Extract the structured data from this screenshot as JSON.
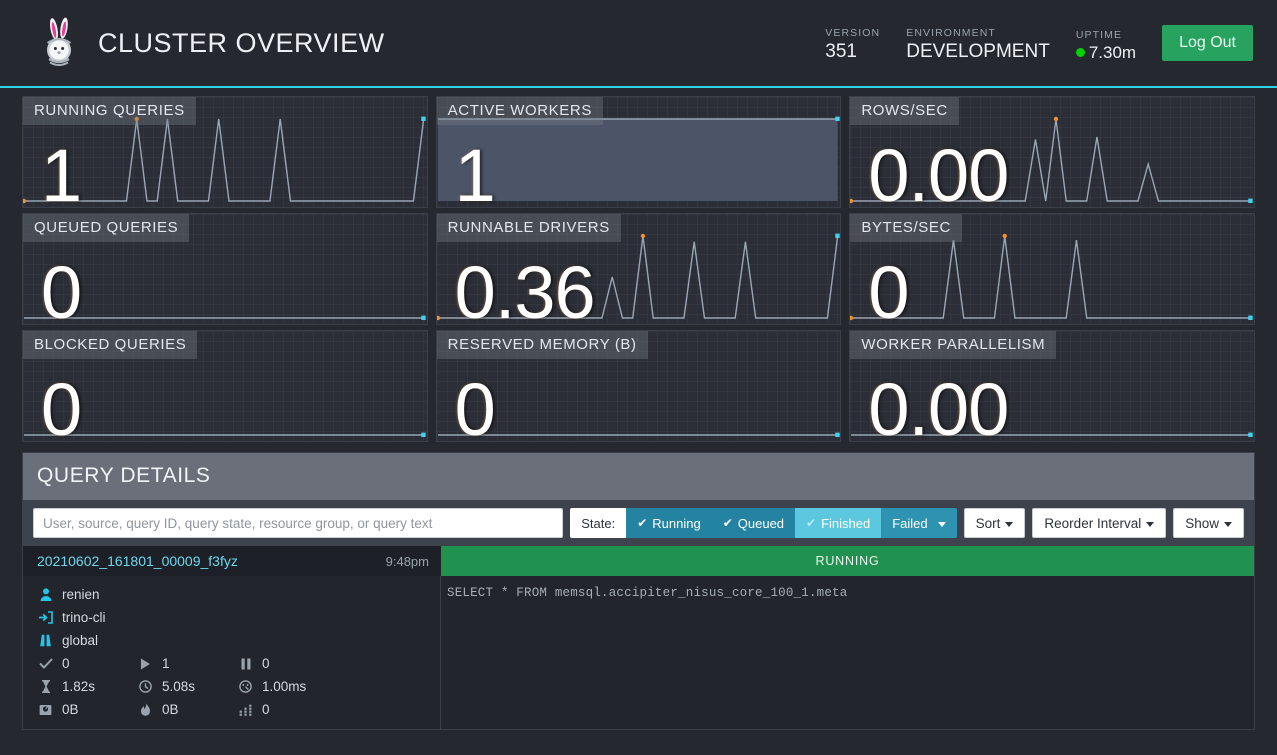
{
  "header": {
    "title": "CLUSTER OVERVIEW",
    "logo_icon": "rabbit-logo-icon",
    "version_label": "VERSION",
    "version_value": "351",
    "environment_label": "ENVIRONMENT",
    "environment_value": "DEVELOPMENT",
    "uptime_label": "UPTIME",
    "uptime_value": "7.30m",
    "logout_label": "Log Out",
    "accent_color": "#2ed3e3",
    "live_dot_color": "#00d100",
    "logout_color": "#27a25f"
  },
  "metrics": [
    {
      "label": "RUNNING QUERIES",
      "value": "1",
      "chart_data": {
        "type": "line",
        "title": "RUNNING QUERIES",
        "x": [
          0,
          1,
          2,
          3,
          4,
          5,
          6,
          7,
          8,
          9,
          10,
          11,
          12,
          13,
          14,
          15,
          16,
          17,
          18,
          19,
          20,
          21,
          22,
          23,
          24,
          25,
          26,
          27,
          28,
          29,
          30,
          31,
          32,
          33,
          34,
          35,
          36,
          37,
          38,
          39
        ],
        "values": [
          0,
          0,
          0,
          0,
          0,
          0,
          0,
          0,
          0,
          0,
          0,
          1,
          0,
          0,
          1,
          0,
          0,
          0,
          0,
          1,
          0,
          0,
          0,
          0,
          0,
          1,
          0,
          0,
          0,
          0,
          0,
          0,
          0,
          0,
          0,
          0,
          0,
          0,
          0,
          1
        ],
        "ylim": [
          0,
          1
        ],
        "grid": true,
        "last_point_color": "#3fd2f0",
        "peak_point_color": "#f0922c"
      }
    },
    {
      "label": "ACTIVE WORKERS",
      "value": "1",
      "chart_data": {
        "type": "area",
        "title": "ACTIVE WORKERS",
        "x": [
          0,
          1,
          2,
          3,
          4,
          5,
          6,
          7,
          8,
          9,
          10,
          11,
          12,
          13,
          14,
          15,
          16,
          17,
          18,
          19,
          20,
          21,
          22,
          23,
          24,
          25,
          26,
          27,
          28,
          29,
          30,
          31,
          32,
          33,
          34,
          35,
          36,
          37,
          38,
          39
        ],
        "values": [
          1,
          1,
          1,
          1,
          1,
          1,
          1,
          1,
          1,
          1,
          1,
          1,
          1,
          1,
          1,
          1,
          1,
          1,
          1,
          1,
          1,
          1,
          1,
          1,
          1,
          1,
          1,
          1,
          1,
          1,
          1,
          1,
          1,
          1,
          1,
          1,
          1,
          1,
          1,
          1
        ],
        "ylim": [
          0,
          1
        ],
        "grid": true,
        "last_point_color": "#3fd2f0",
        "fill": true
      }
    },
    {
      "label": "ROWS/SEC",
      "value": "0.00",
      "chart_data": {
        "type": "line",
        "title": "ROWS/SEC",
        "x": [
          0,
          1,
          2,
          3,
          4,
          5,
          6,
          7,
          8,
          9,
          10,
          11,
          12,
          13,
          14,
          15,
          16,
          17,
          18,
          19,
          20,
          21,
          22,
          23,
          24,
          25,
          26,
          27,
          28,
          29,
          30,
          31,
          32,
          33,
          34,
          35,
          36,
          37,
          38,
          39
        ],
        "values": [
          0,
          0,
          0,
          0,
          0,
          0,
          0,
          0,
          0,
          0,
          0,
          0,
          0,
          0,
          0,
          0,
          0,
          0,
          0.75,
          0,
          1,
          0,
          0,
          0,
          0.78,
          0,
          0,
          0,
          0,
          0.45,
          0,
          0,
          0,
          0,
          0,
          0,
          0,
          0,
          0,
          0
        ],
        "ylim": [
          0,
          1
        ],
        "grid": true,
        "last_point_color": "#3fd2f0",
        "peak_point_color": "#f0922c"
      }
    },
    {
      "label": "QUEUED QUERIES",
      "value": "0",
      "chart_data": {
        "type": "line",
        "title": "QUEUED QUERIES",
        "x": [
          0,
          1,
          2,
          3,
          4,
          5,
          6,
          7,
          8,
          9,
          10,
          11,
          12,
          13,
          14,
          15,
          16,
          17,
          18,
          19,
          20,
          21,
          22,
          23,
          24,
          25,
          26,
          27,
          28,
          29,
          30,
          31,
          32,
          33,
          34,
          35,
          36,
          37,
          38,
          39
        ],
        "values": [
          0,
          0,
          0,
          0,
          0,
          0,
          0,
          0,
          0,
          0,
          0,
          0,
          0,
          0,
          0,
          0,
          0,
          0,
          0,
          0,
          0,
          0,
          0,
          0,
          0,
          0,
          0,
          0,
          0,
          0,
          0,
          0,
          0,
          0,
          0,
          0,
          0,
          0,
          0,
          0
        ],
        "ylim": [
          0,
          1
        ],
        "grid": true,
        "last_point_color": "#3fd2f0"
      }
    },
    {
      "label": "RUNNABLE DRIVERS",
      "value": "0.36",
      "chart_data": {
        "type": "line",
        "title": "RUNNABLE DRIVERS",
        "x": [
          0,
          1,
          2,
          3,
          4,
          5,
          6,
          7,
          8,
          9,
          10,
          11,
          12,
          13,
          14,
          15,
          16,
          17,
          18,
          19,
          20,
          21,
          22,
          23,
          24,
          25,
          26,
          27,
          28,
          29,
          30,
          31,
          32,
          33,
          34,
          35,
          36,
          37,
          38,
          39
        ],
        "values": [
          0,
          0,
          0,
          0,
          0,
          0,
          0,
          0,
          0,
          0,
          0,
          0,
          0,
          0,
          0,
          0,
          0,
          0.5,
          0,
          0,
          1,
          0,
          0,
          0,
          0,
          0.93,
          0,
          0,
          0,
          0,
          0.93,
          0,
          0,
          0,
          0,
          0,
          0,
          0,
          0,
          1
        ],
        "ylim": [
          0,
          1
        ],
        "grid": true,
        "last_point_color": "#3fd2f0",
        "peak_point_color": "#f0922c"
      }
    },
    {
      "label": "BYTES/SEC",
      "value": "0",
      "chart_data": {
        "type": "line",
        "title": "BYTES/SEC",
        "x": [
          0,
          1,
          2,
          3,
          4,
          5,
          6,
          7,
          8,
          9,
          10,
          11,
          12,
          13,
          14,
          15,
          16,
          17,
          18,
          19,
          20,
          21,
          22,
          23,
          24,
          25,
          26,
          27,
          28,
          29,
          30,
          31,
          32,
          33,
          34,
          35,
          36,
          37,
          38,
          39
        ],
        "values": [
          0,
          0,
          0,
          0,
          0,
          0,
          0,
          0,
          0,
          0,
          0.95,
          0,
          0,
          0,
          0,
          1,
          0,
          0,
          0,
          0,
          0,
          0,
          0.95,
          0,
          0,
          0,
          0,
          0,
          0,
          0,
          0,
          0,
          0,
          0,
          0,
          0,
          0,
          0,
          0,
          0
        ],
        "ylim": [
          0,
          1
        ],
        "grid": true,
        "last_point_color": "#3fd2f0",
        "peak_point_color": "#f0922c"
      }
    },
    {
      "label": "BLOCKED QUERIES",
      "value": "0",
      "chart_data": {
        "type": "line",
        "title": "BLOCKED QUERIES",
        "x": [
          0,
          1,
          2,
          3,
          4,
          5,
          6,
          7,
          8,
          9,
          10,
          11,
          12,
          13,
          14,
          15,
          16,
          17,
          18,
          19,
          20,
          21,
          22,
          23,
          24,
          25,
          26,
          27,
          28,
          29,
          30,
          31,
          32,
          33,
          34,
          35,
          36,
          37,
          38,
          39
        ],
        "values": [
          0,
          0,
          0,
          0,
          0,
          0,
          0,
          0,
          0,
          0,
          0,
          0,
          0,
          0,
          0,
          0,
          0,
          0,
          0,
          0,
          0,
          0,
          0,
          0,
          0,
          0,
          0,
          0,
          0,
          0,
          0,
          0,
          0,
          0,
          0,
          0,
          0,
          0,
          0,
          0
        ],
        "ylim": [
          0,
          1
        ],
        "grid": true,
        "last_point_color": "#3fd2f0"
      }
    },
    {
      "label": "RESERVED MEMORY (B)",
      "value": "0",
      "chart_data": {
        "type": "line",
        "title": "RESERVED MEMORY (B)",
        "x": [
          0,
          1,
          2,
          3,
          4,
          5,
          6,
          7,
          8,
          9,
          10,
          11,
          12,
          13,
          14,
          15,
          16,
          17,
          18,
          19,
          20,
          21,
          22,
          23,
          24,
          25,
          26,
          27,
          28,
          29,
          30,
          31,
          32,
          33,
          34,
          35,
          36,
          37,
          38,
          39
        ],
        "values": [
          0,
          0,
          0,
          0,
          0,
          0,
          0,
          0,
          0,
          0,
          0,
          0,
          0,
          0,
          0,
          0,
          0,
          0,
          0,
          0,
          0,
          0,
          0,
          0,
          0,
          0,
          0,
          0,
          0,
          0,
          0,
          0,
          0,
          0,
          0,
          0,
          0,
          0,
          0,
          0
        ],
        "ylim": [
          0,
          1
        ],
        "grid": true,
        "last_point_color": "#3fd2f0"
      }
    },
    {
      "label": "WORKER PARALLELISM",
      "value": "0.00",
      "chart_data": {
        "type": "line",
        "title": "WORKER PARALLELISM",
        "x": [
          0,
          1,
          2,
          3,
          4,
          5,
          6,
          7,
          8,
          9,
          10,
          11,
          12,
          13,
          14,
          15,
          16,
          17,
          18,
          19,
          20,
          21,
          22,
          23,
          24,
          25,
          26,
          27,
          28,
          29,
          30,
          31,
          32,
          33,
          34,
          35,
          36,
          37,
          38,
          39
        ],
        "values": [
          0,
          0,
          0,
          0,
          0,
          0,
          0,
          0,
          0,
          0,
          0,
          0,
          0,
          0,
          0,
          0,
          0,
          0,
          0,
          0,
          0,
          0,
          0,
          0,
          0,
          0,
          0,
          0,
          0,
          0,
          0,
          0,
          0,
          0,
          0,
          0,
          0,
          0,
          0,
          0
        ],
        "ylim": [
          0,
          1
        ],
        "grid": true,
        "last_point_color": "#3fd2f0"
      }
    }
  ],
  "query_details": {
    "panel_title": "QUERY DETAILS",
    "search_placeholder": "User, source, query ID, query state, resource group, or query text",
    "search_value": "",
    "state_label": "State:",
    "state_filters": [
      {
        "label": "Running",
        "checked": true,
        "style": "on",
        "caret": false
      },
      {
        "label": "Queued",
        "checked": true,
        "style": "on",
        "caret": false
      },
      {
        "label": "Finished",
        "checked": true,
        "style": "lite",
        "caret": false
      },
      {
        "label": "Failed",
        "checked": false,
        "style": "fail",
        "caret": true
      }
    ],
    "dropdowns": [
      {
        "label": "Sort"
      },
      {
        "label": "Reorder Interval"
      },
      {
        "label": "Show"
      }
    ]
  },
  "query": {
    "id": "20210602_161801_00009_f3fyz",
    "time": "9:48pm",
    "state": "RUNNING",
    "state_color": "#219150",
    "user": "renien",
    "source": "trino-cli",
    "resource_group": "global",
    "user_icon": "user-icon",
    "source_icon": "sign-in-icon",
    "group_icon": "road-icon",
    "stats": [
      {
        "icon": "check-icon",
        "value": "0"
      },
      {
        "icon": "play-icon",
        "value": "1"
      },
      {
        "icon": "pause-icon",
        "value": "0"
      },
      {
        "icon": "hourglass-icon",
        "value": "1.82s"
      },
      {
        "icon": "clock-icon",
        "value": "5.08s"
      },
      {
        "icon": "gauge-icon",
        "value": "1.00ms"
      },
      {
        "icon": "scale-icon",
        "value": "0B"
      },
      {
        "icon": "fire-icon",
        "value": "0B"
      },
      {
        "icon": "bars-icon",
        "value": "0"
      }
    ],
    "sql": "SELECT * FROM memsql.accipiter_nisus_core_100_1.meta"
  }
}
